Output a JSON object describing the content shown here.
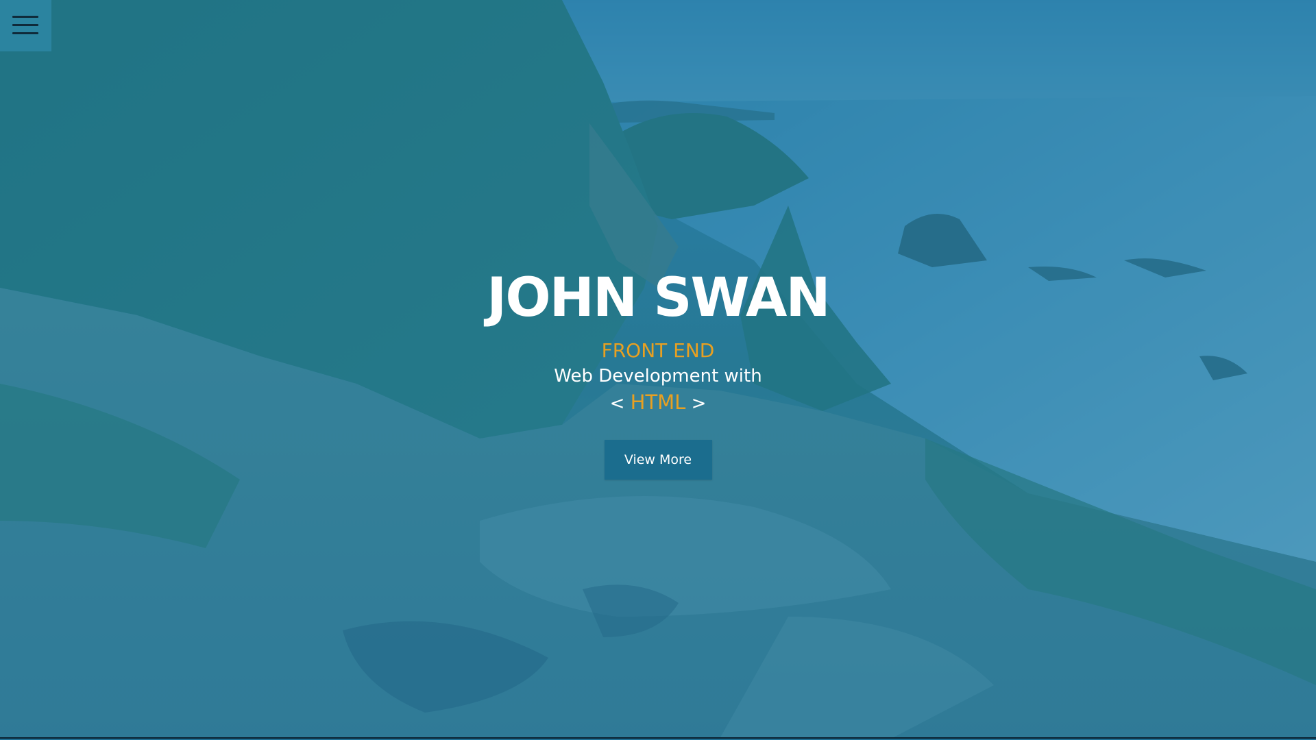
{
  "menu": {
    "icon": "hamburger-menu-icon"
  },
  "hero": {
    "name": "JOHN SWAN",
    "role": "FRONT END",
    "description": "Web Development with",
    "tech_prefix": "<",
    "tech": "HTML",
    "tech_suffix": ">",
    "button_label": "View More"
  },
  "colors": {
    "accent": "#e8a021",
    "button": "#1b6d8e",
    "overlay": "#2278a5"
  }
}
